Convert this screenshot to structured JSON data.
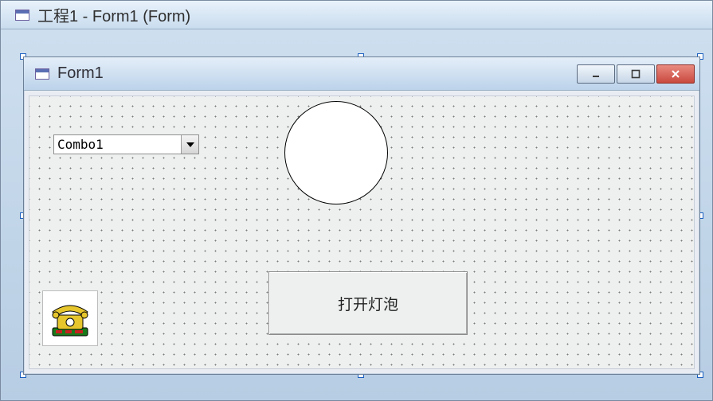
{
  "designer": {
    "title": "工程1 - Form1 (Form)"
  },
  "form": {
    "title": "Form1"
  },
  "controls": {
    "combo1": {
      "text": "Combo1"
    },
    "command1": {
      "caption": "打开灯泡"
    }
  },
  "icons": {
    "form_icon": "form-icon",
    "minimize": "minimize-icon",
    "maximize": "maximize-icon",
    "close": "close-icon",
    "phone": "phone-icon"
  }
}
